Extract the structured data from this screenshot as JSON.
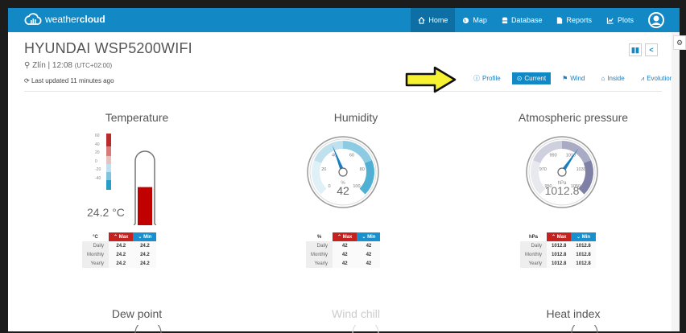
{
  "nav": {
    "brand": "weather",
    "brand_bold": "cloud",
    "items": [
      {
        "label": "Home",
        "icon": "home-icon",
        "active": true
      },
      {
        "label": "Map",
        "icon": "globe-icon"
      },
      {
        "label": "Database",
        "icon": "database-icon"
      },
      {
        "label": "Reports",
        "icon": "file-icon"
      },
      {
        "label": "Plots",
        "icon": "chart-icon"
      }
    ]
  },
  "station": {
    "name": "HYUNDAI WSP5200WIFI",
    "location": "Zlín | 12:08",
    "timezone": "(UTC+02:00)",
    "updated": "Last updated 11 minutes ago"
  },
  "tabs": [
    {
      "label": "Profile",
      "icon": "info-icon"
    },
    {
      "label": "Current",
      "icon": "clock-icon",
      "active": true
    },
    {
      "label": "Wind",
      "icon": "flag-icon"
    },
    {
      "label": "Inside",
      "icon": "home-icon"
    },
    {
      "label": "Evolution",
      "icon": "chart-icon"
    }
  ],
  "cards": {
    "temperature": {
      "title": "Temperature",
      "reading": "24.2 °C",
      "value": 24.2,
      "scale": [
        "60",
        "40",
        "20",
        "0",
        "-20",
        "-40"
      ]
    },
    "humidity": {
      "title": "Humidity",
      "reading": "42",
      "unit": "%",
      "value": 42,
      "ticks": [
        "0",
        "20",
        "40",
        "60",
        "80",
        "100"
      ]
    },
    "pressure": {
      "title": "Atmospheric pressure",
      "reading": "1012.8",
      "unit": "hPa",
      "value": 1012.8,
      "ticks": [
        "950",
        "970",
        "990",
        "1010",
        "1030",
        "1050"
      ]
    },
    "dewpoint": {
      "title": "Dew point"
    },
    "windchill": {
      "title": "Wind chill"
    },
    "heatindex": {
      "title": "Heat index"
    }
  },
  "tables": {
    "headers": {
      "max": "Max",
      "min": "Min"
    },
    "rows": [
      "Daily",
      "Monthly",
      "Yearly"
    ],
    "temperature": {
      "unit": "°C",
      "values": [
        [
          "24.2",
          "24.2"
        ],
        [
          "24.2",
          "24.2"
        ],
        [
          "24.2",
          "24.2"
        ]
      ]
    },
    "humidity": {
      "unit": "%",
      "values": [
        [
          "42",
          "42"
        ],
        [
          "42",
          "42"
        ],
        [
          "42",
          "42"
        ]
      ]
    },
    "pressure": {
      "unit": "hPa",
      "values": [
        [
          "1012.8",
          "1012.8"
        ],
        [
          "1012.8",
          "1012.8"
        ],
        [
          "1012.8",
          "1012.8"
        ]
      ]
    }
  },
  "colors": {
    "brand": "#1288c5",
    "max": "#c6211e",
    "min": "#1a8fce"
  }
}
